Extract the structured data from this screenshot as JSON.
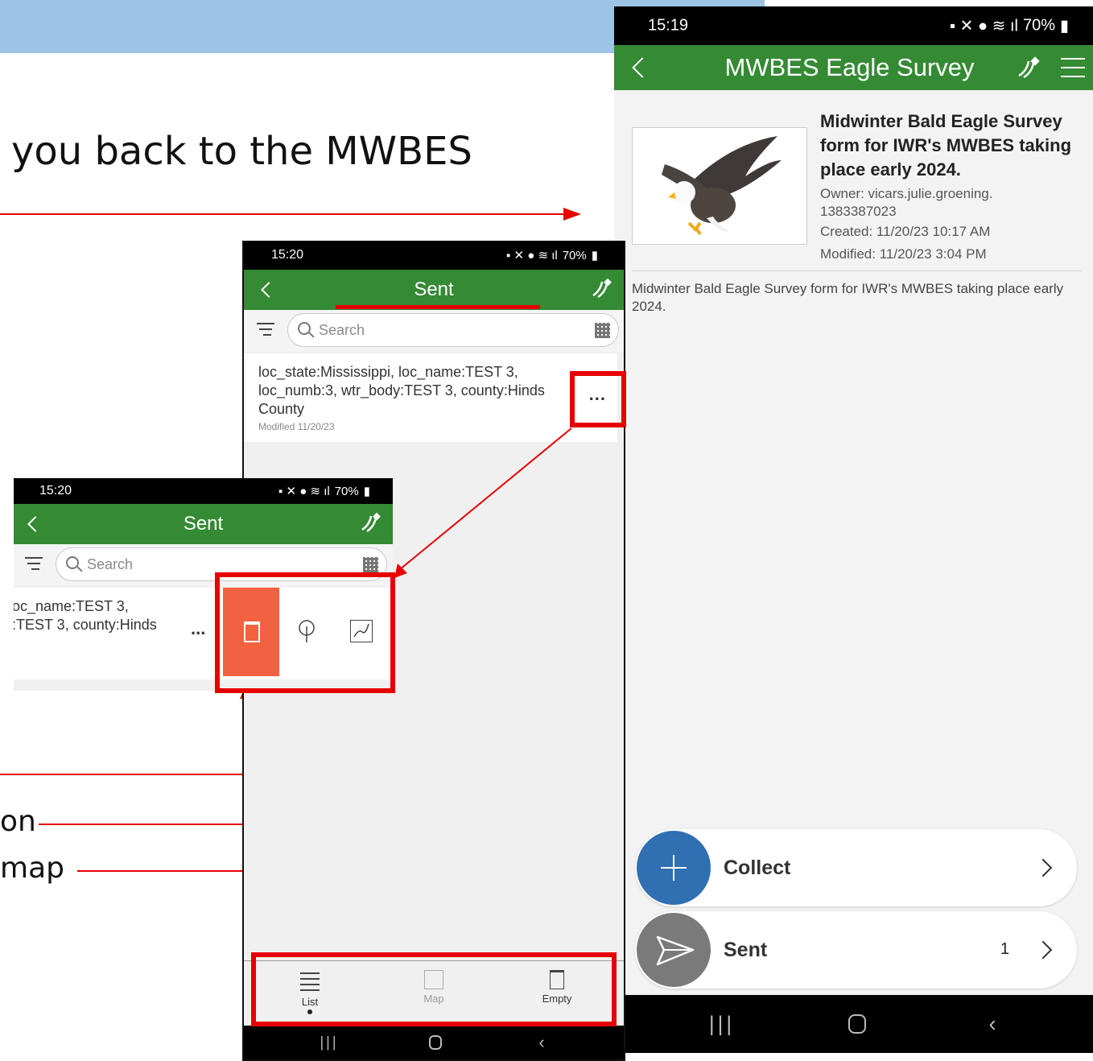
{
  "slide": {
    "caption": "you back to the MWBES",
    "frag_on": "on",
    "frag_map": "map"
  },
  "phone_right": {
    "time": "15:19",
    "battery": "70%",
    "title": "MWBES Eagle Survey",
    "form_title": "Midwinter Bald Eagle Survey form for IWR's MWBES taking place early 2024.",
    "owner": "Owner: vicars.julie.groening. 1383387023",
    "created": "Created: 11/20/23 10:17 AM",
    "modified": "Modified: 11/20/23 3:04 PM",
    "description": "Midwinter Bald Eagle Survey form for IWR's MWBES taking place early 2024.",
    "collect_label": "Collect",
    "sent_label": "Sent",
    "sent_count": "1"
  },
  "phone_mid": {
    "time": "15:20",
    "battery": "70%",
    "title": "Sent",
    "search_placeholder": "Search",
    "item_text": "loc_state:Mississippi, loc_name:TEST 3, loc_numb:3, wtr_body:TEST 3, county:Hinds County",
    "item_modified": "Modified 11/20/23",
    "more": "...",
    "tabs": [
      {
        "label": "List"
      },
      {
        "label": "Map"
      },
      {
        "label": "Empty"
      }
    ]
  },
  "phone_left": {
    "time": "15:20",
    "battery": "70%",
    "title": "Sent",
    "search_placeholder": "Search",
    "item_line1": "oc_name:TEST 3,",
    "item_line2": ":TEST 3, county:Hinds",
    "more": "..."
  },
  "colors": {
    "appbar": "#358a34",
    "accent_red": "#e60000",
    "delete_red": "#f26140",
    "collect_blue": "#2f6fb2",
    "sent_gray": "#7a7a7a"
  }
}
